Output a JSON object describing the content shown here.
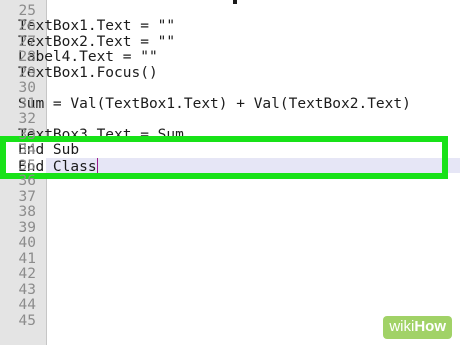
{
  "editor": {
    "lines": [
      {
        "number": "25",
        "code": ""
      },
      {
        "number": "26",
        "code": "TextBox1.Text = \"\""
      },
      {
        "number": "27",
        "code": "TextBox2.Text = \"\""
      },
      {
        "number": "28",
        "code": "Label4.Text = \"\""
      },
      {
        "number": "29",
        "code": "TextBox1.Focus()"
      },
      {
        "number": "30",
        "code": ""
      },
      {
        "number": "31",
        "code": "Sum = Val(TextBox1.Text) + Val(TextBox2.Text)"
      },
      {
        "number": "32",
        "code": ""
      },
      {
        "number": "33",
        "code": "TextBox3.Text = Sum"
      },
      {
        "number": "34",
        "code": "End Sub"
      },
      {
        "number": "35",
        "code": "End Class"
      },
      {
        "number": "36",
        "code": ""
      },
      {
        "number": "37",
        "code": ""
      },
      {
        "number": "38",
        "code": ""
      },
      {
        "number": "39",
        "code": ""
      },
      {
        "number": "40",
        "code": ""
      },
      {
        "number": "41",
        "code": ""
      },
      {
        "number": "42",
        "code": ""
      },
      {
        "number": "43",
        "code": ""
      },
      {
        "number": "44",
        "code": ""
      },
      {
        "number": "45",
        "code": ""
      }
    ],
    "highlighted_lines": [
      "34",
      "35"
    ],
    "current_line": "35",
    "highlight_color": "#18e218"
  },
  "watermark": {
    "prefix": "wiki",
    "suffix": "How"
  }
}
